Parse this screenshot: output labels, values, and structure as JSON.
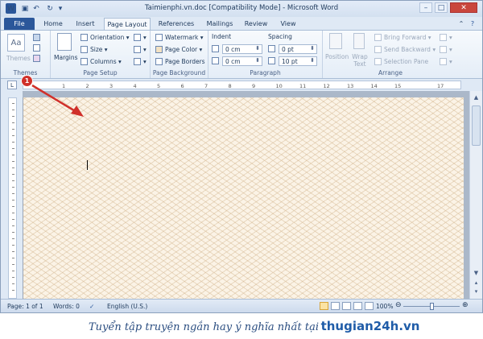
{
  "window": {
    "title": "Taimienphi.vn.doc [Compatibility Mode] - Microsoft Word",
    "app_icon": "W"
  },
  "quick_access": {
    "save_icon": "save-icon",
    "undo_icon": "undo-icon",
    "redo_icon": "redo-icon"
  },
  "tabs": [
    "File",
    "Home",
    "Insert",
    "Page Layout",
    "References",
    "Mailings",
    "Review",
    "View"
  ],
  "active_tab": "Page Layout",
  "ribbon": {
    "themes": {
      "label": "Themes",
      "group": "Themes"
    },
    "page_setup": {
      "margins": "Margins",
      "orientation": "Orientation",
      "size": "Size",
      "columns": "Columns",
      "group": "Page Setup"
    },
    "page_background": {
      "watermark": "Watermark",
      "page_color": "Page Color",
      "page_borders": "Page Borders",
      "group": "Page Background"
    },
    "paragraph": {
      "indent": "Indent",
      "spacing": "Spacing",
      "indent_left": "0 cm",
      "indent_right": "0 cm",
      "spacing_before": "0 pt",
      "spacing_after": "10 pt",
      "group": "Paragraph"
    },
    "arrange": {
      "position": "Position",
      "wrap_text": "Wrap Text",
      "bring_forward": "Bring Forward",
      "send_backward": "Send Backward",
      "selection_pane": "Selection Pane",
      "group": "Arrange"
    }
  },
  "ruler_numbers": [
    "1",
    "2",
    "3",
    "4",
    "5",
    "6",
    "7",
    "8",
    "9",
    "10",
    "11",
    "12",
    "13",
    "14",
    "15",
    "17"
  ],
  "marker": {
    "number": "1"
  },
  "status": {
    "page": "Page: 1 of 1",
    "words": "Words: 0",
    "language": "English (U.S.)",
    "zoom": "100%"
  },
  "caption": {
    "text": "Tuyển tập truyện ngắn hay ý nghĩa nhất tại",
    "brand": "thugian24h.vn"
  },
  "colors": {
    "file_tab": "#2b579a",
    "page_background": "#fbf3e6",
    "marker": "#d0302a",
    "arrow": "#d0302a"
  }
}
